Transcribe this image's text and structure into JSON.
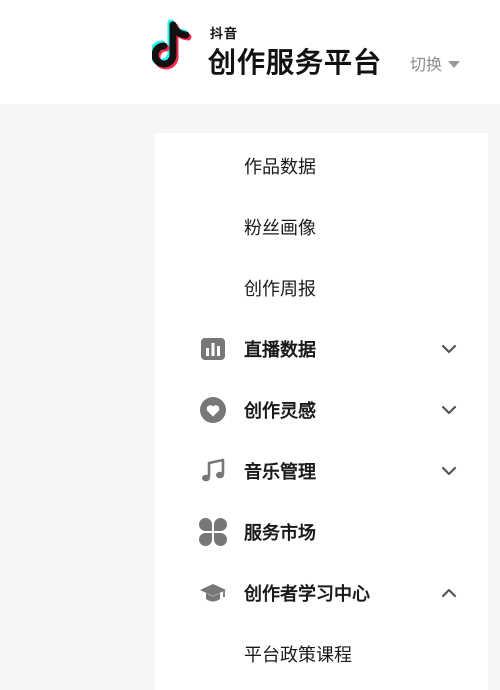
{
  "header": {
    "logo_small": "抖音",
    "logo_title": "创作服务平台",
    "switch_label": "切换"
  },
  "nav": {
    "items": [
      {
        "label": "作品数据"
      },
      {
        "label": "粉丝画像"
      },
      {
        "label": "创作周报"
      },
      {
        "label": "直播数据",
        "icon": "bar-chart-icon",
        "state": "collapsed"
      },
      {
        "label": "创作灵感",
        "icon": "heart-icon",
        "state": "collapsed"
      },
      {
        "label": "音乐管理",
        "icon": "music-note-icon",
        "state": "collapsed"
      },
      {
        "label": "服务市场",
        "icon": "grid-blocks-icon"
      },
      {
        "label": "创作者学习中心",
        "icon": "graduation-cap-icon",
        "state": "expanded"
      },
      {
        "label": "平台政策课程"
      }
    ]
  },
  "colors": {
    "brand_cyan": "#25f4ee",
    "brand_red": "#fe2c55",
    "icon_gray": "#777777",
    "text": "#1a1a1a"
  }
}
